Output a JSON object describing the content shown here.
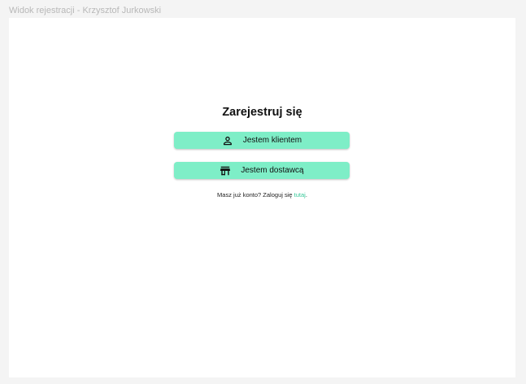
{
  "frame": {
    "title": "Widok rejestracji - Krzysztof Jurkowski"
  },
  "register": {
    "heading": "Zarejestruj się",
    "buttons": [
      {
        "label": "Jestem klientem",
        "icon": "person-icon"
      },
      {
        "label": "Jestem dostawcą",
        "icon": "store-icon"
      }
    ],
    "login_prompt": "Masz już konto? Zaloguj się ",
    "login_link": "tutaj",
    "login_suffix": "."
  },
  "colors": {
    "button_bg": "#7eeec7",
    "link": "#38c99a",
    "canvas": "#f4f4f4"
  }
}
